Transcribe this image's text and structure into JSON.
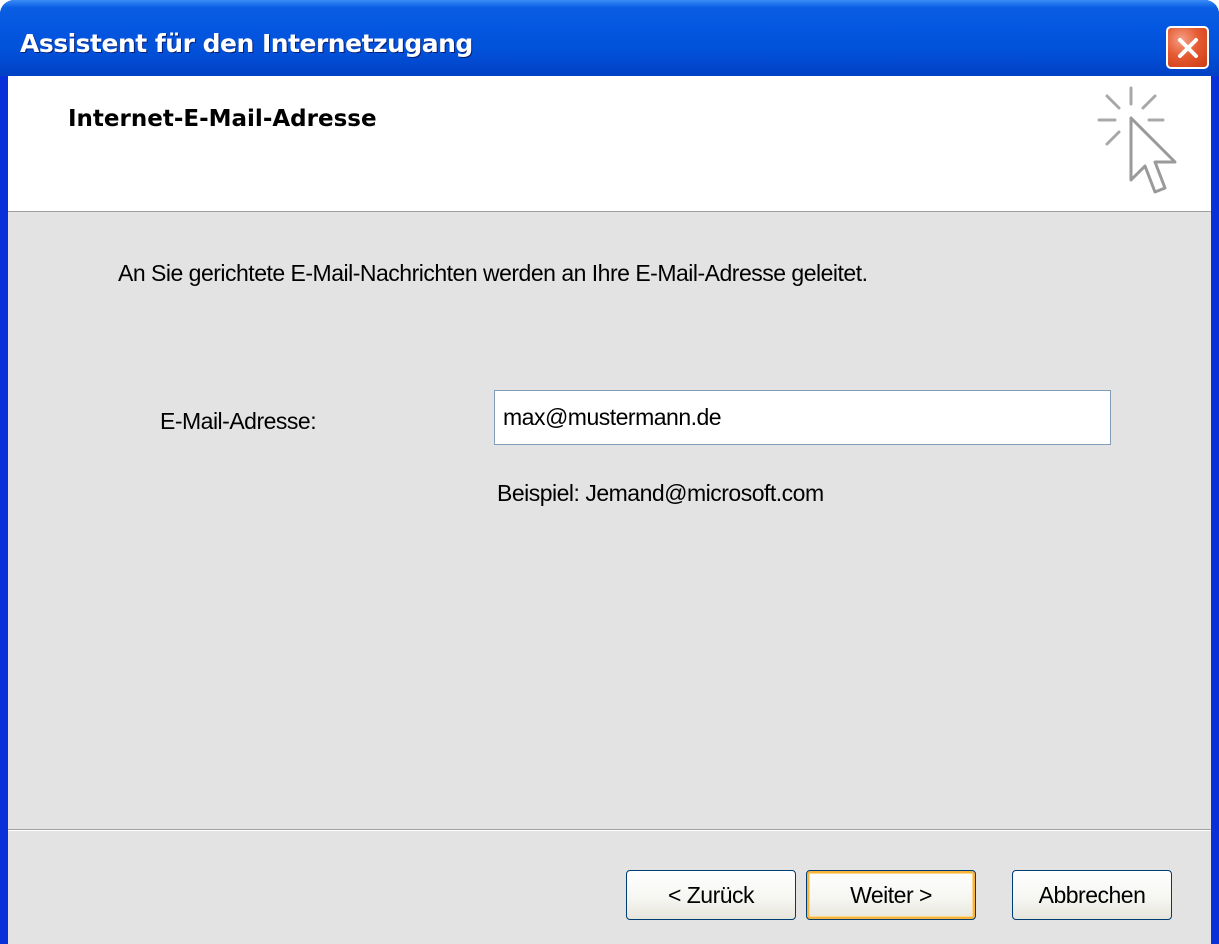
{
  "window": {
    "title": "Assistent für den Internetzugang"
  },
  "header": {
    "title": "Internet-E-Mail-Adresse",
    "icon": "wizard-cursor-icon"
  },
  "content": {
    "intro": "An Sie gerichtete E-Mail-Nachrichten werden an Ihre E-Mail-Adresse geleitet.",
    "email_label": "E-Mail-Adresse:",
    "email_value": "max@mustermann.de",
    "example": "Beispiel: Jemand@microsoft.com"
  },
  "buttons": {
    "back": "< Zurück",
    "next": "Weiter >",
    "cancel": "Abbrechen"
  },
  "colors": {
    "titlebar": "#0356e0",
    "close": "#e55b32",
    "dialog_bg": "#e3e3e3",
    "focus_border": "#f8b33a"
  }
}
